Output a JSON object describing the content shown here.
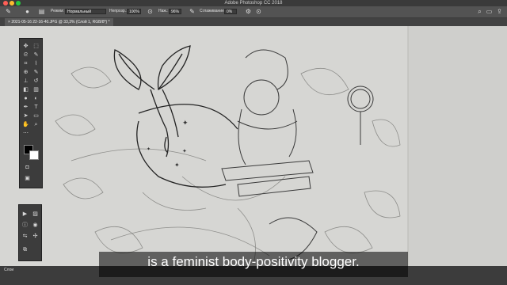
{
  "window": {
    "app_title": "Adobe Photoshop CC 2018",
    "traffic_colors": [
      "#ff5f57",
      "#febc2e",
      "#28c840"
    ]
  },
  "options_bar": {
    "mode_label": "Режим:",
    "mode_value": "Нормальный",
    "opacity_label": "Непрозр.:",
    "opacity_value": "100%",
    "pressure_label": "Наж.:",
    "pressure_value": "96%",
    "smoothing_label": "Сглаживание:",
    "smoothing_value": "0%"
  },
  "document_tab": {
    "label": "2021-05-16 22-16-40.JPG @ 33,3% (Слой 1, RGB/8*) *"
  },
  "layers_panel": {
    "label": "Слои"
  },
  "caption": {
    "text": "is a feminist body-positivity blogger."
  },
  "colors": {
    "foreground": "#000000",
    "background": "#ffffff"
  }
}
